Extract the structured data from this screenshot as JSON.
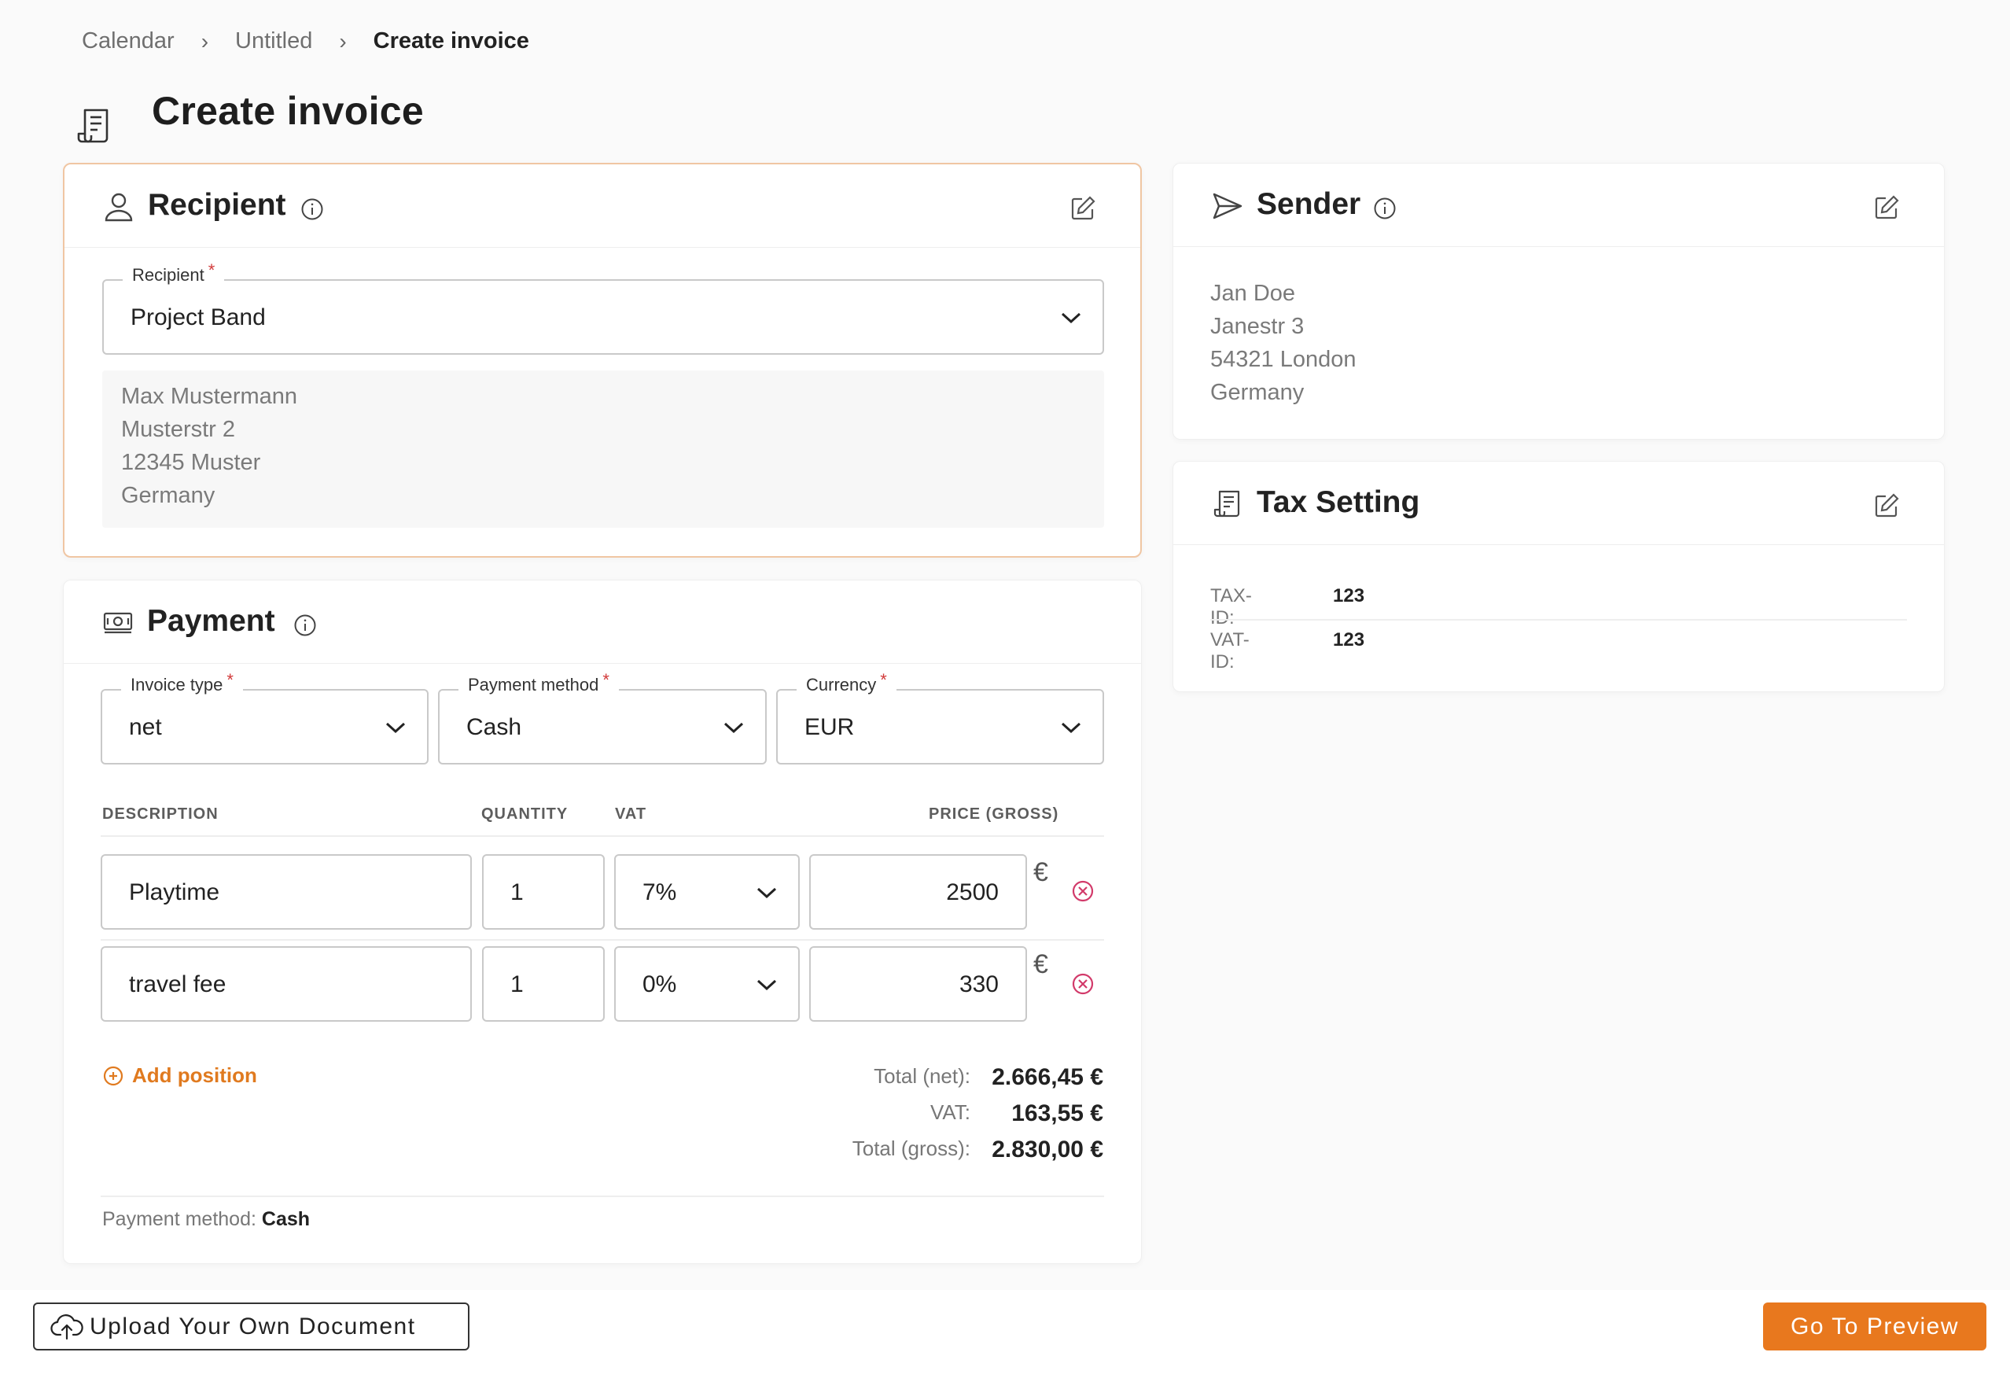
{
  "breadcrumb": {
    "items": [
      "Calendar",
      "Untitled"
    ],
    "current": "Create invoice"
  },
  "page": {
    "title": "Create invoice",
    "icon": "receipt-icon"
  },
  "recipient": {
    "title": "Recipient",
    "field_label": "Recipient",
    "required_mark": "*",
    "selected": "Project Band",
    "address": [
      "Max Mustermann",
      "Musterstr 2",
      "12345 Muster",
      "Germany"
    ]
  },
  "sender": {
    "title": "Sender",
    "address": [
      "Jan Doe",
      "Janestr 3",
      "54321 London",
      "Germany"
    ]
  },
  "tax": {
    "title": "Tax Setting",
    "rows": [
      {
        "label": "TAX-ID:",
        "value": "123"
      },
      {
        "label": "VAT-ID:",
        "value": "123"
      }
    ]
  },
  "payment": {
    "title": "Payment",
    "invoice_type": {
      "label": "Invoice type",
      "value": "net"
    },
    "payment_method": {
      "label": "Payment method",
      "value": "Cash"
    },
    "currency": {
      "label": "Currency",
      "value": "EUR"
    },
    "columns": [
      "DESCRIPTION",
      "QUANTITY",
      "VAT",
      "PRICE (GROSS)"
    ],
    "positions": [
      {
        "description": "Playtime",
        "quantity": "1",
        "vat": "7%",
        "price": "2500",
        "currency_symbol": "€"
      },
      {
        "description": "travel fee",
        "quantity": "1",
        "vat": "0%",
        "price": "330",
        "currency_symbol": "€"
      }
    ],
    "add_position": "Add position",
    "totals": {
      "net_label": "Total (net):",
      "net_value": "2.666,45 €",
      "vat_label": "VAT:",
      "vat_value": "163,55 €",
      "gross_label": "Total (gross):",
      "gross_value": "2.830,00 €"
    },
    "method_line_label": "Payment method:",
    "method_line_value": "Cash"
  },
  "footer": {
    "upload_label": "Upload Your Own Document",
    "preview_label": "Go To Preview"
  },
  "colors": {
    "accent": "#e8781e",
    "danger": "#d23a6a",
    "active_border": "#f0c6a3"
  }
}
